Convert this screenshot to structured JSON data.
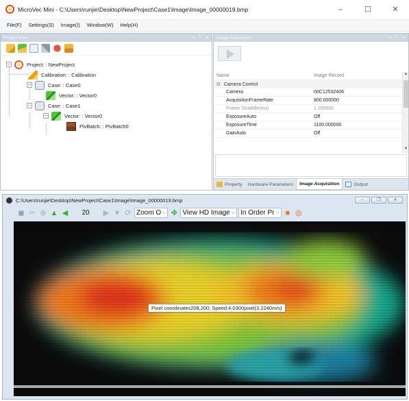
{
  "window": {
    "title": "MicroVec Mini - C:\\Users\\runjie\\Desktop\\NewProject\\Case1\\Image\\Image_00000019.bmp",
    "controls": [
      "–",
      "☐",
      "✕"
    ]
  },
  "menu": [
    "File(F)",
    "Settings(S)",
    "Image(I)",
    "Window(W)",
    "Help(H)"
  ],
  "project_view": {
    "title": "Project View",
    "toolbar_icons": [
      "open-folder-icon",
      "new-item-icon",
      "save-icon",
      "tools-icon",
      "delete-icon",
      "paste-icon"
    ],
    "tree": [
      {
        "label": "Project: : NewProject",
        "icon": "project-icon",
        "expander": "–"
      },
      {
        "label": "Calibration: : Calibration",
        "icon": "calibration-icon"
      },
      {
        "label": "Case: : Case0",
        "icon": "case-icon",
        "expander": "–"
      },
      {
        "label": "Vector: : Vector0",
        "icon": "vector-icon"
      },
      {
        "label": "Case: : Case1",
        "icon": "case-icon",
        "expander": "–"
      },
      {
        "label": "Vector: : Vector0",
        "icon": "vector-icon",
        "expander": "–"
      },
      {
        "label": "PivBatch: : PivBatch0",
        "icon": "pivbatch-icon"
      }
    ]
  },
  "image_acquisition": {
    "title": "Image Acquisition",
    "grid_header": {
      "name": "Name",
      "value": "Image Record"
    },
    "category": "Camera Control",
    "properties": [
      {
        "name": "Camera",
        "value": "00C12532406"
      },
      {
        "name": "AcquisitionFrameRate",
        "value": "800.000000"
      },
      {
        "name": "Frame Straddle(ms)",
        "value": "1.250000"
      },
      {
        "name": "ExposureAuto",
        "value": "Off"
      },
      {
        "name": "ExposureTime",
        "value": "1100.000000"
      },
      {
        "name": "GainAuto",
        "value": "Off"
      }
    ],
    "tabs": [
      "Property",
      "Hardware Parameters",
      "Image Acquisition",
      "Output"
    ],
    "active_tab": "Image Acquisition"
  },
  "image_window": {
    "title": "C:\\Users\\runjie\\Desktop\\NewProject\\Case1\\Image\\Image_00000019.bmp",
    "frame_number": "20",
    "zoom_combo": "Zoom O",
    "view_combo": "View HD Image",
    "order_combo": "In Order Pr",
    "tooltip": "Pixel coordinates208,200; Speed:4.0300pixel(3.2240m/s)"
  },
  "colors": {
    "panel_header": "#cdd7e2",
    "tab_strip": "#dfe5ec",
    "image_window_bg": "#dce6f1",
    "velocity_high": "#e0321a",
    "velocity_mid": "#f2d21c",
    "velocity_low": "#19b38a"
  }
}
